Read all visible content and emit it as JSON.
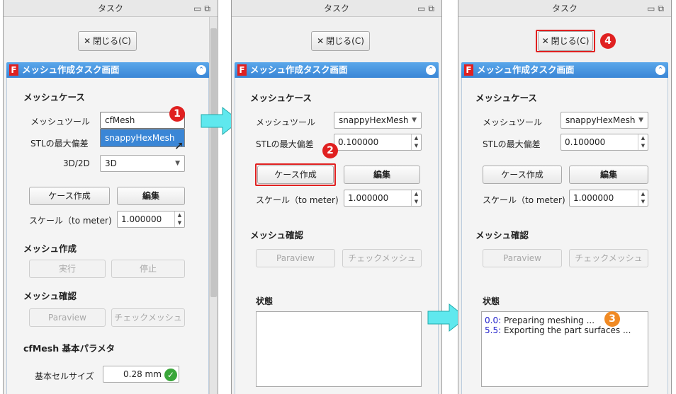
{
  "common": {
    "dock_title": "タスク",
    "close_label": "閉じる(C)",
    "task_title": "メッシュ作成タスク画面",
    "section_mesh_case": "メッシュケース",
    "mesh_tool_label": "メッシュツール",
    "stl_dev_label": "STLの最大偏差",
    "case_create": "ケース作成",
    "edit": "編集",
    "scale_label": "スケール（to meter)",
    "scale_value": "1.000000",
    "section_mesh_check": "メッシュ確認",
    "paraview": "Paraview",
    "check_mesh": "チェックメッシュ",
    "status_label": "状態"
  },
  "panel1": {
    "dropdown_current": "cfMesh",
    "dropdown_options": [
      "snappyHexMesh"
    ],
    "dim_label": "3D/2D",
    "dim_value": "3D",
    "section_mesh_create": "メッシュ作成",
    "run": "実行",
    "stop": "停止",
    "section_cfmesh_params": "cfMesh 基本パラメタ",
    "base_cell_label": "基本セルサイズ",
    "base_cell_value": "0.28 mm",
    "badge": "1"
  },
  "panel2": {
    "mesh_tool_value": "snappyHexMesh",
    "stl_value": "0.100000",
    "badge": "2"
  },
  "panel3": {
    "mesh_tool_value": "snappyHexMesh",
    "stl_value": "0.100000",
    "status_lines": [
      {
        "time": "0.0:",
        "text": " Preparing meshing ..."
      },
      {
        "time": "5.5:",
        "text": " Exporting the part surfaces ..."
      }
    ],
    "badge3": "3",
    "badge4": "4"
  },
  "colors": {
    "accent_blue": "#3a86d6",
    "highlight_red": "#e02020",
    "arrow_cyan": "#5fe8ee",
    "badge_orange": "#f08a24"
  }
}
